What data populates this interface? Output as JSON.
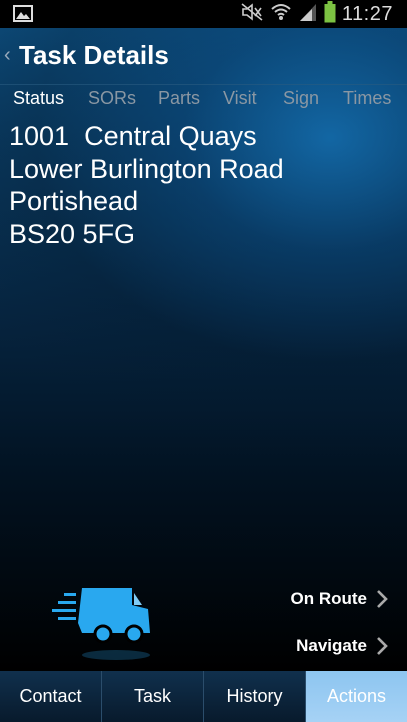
{
  "status_bar": {
    "time": "11:27",
    "icons": [
      "image-notification-icon",
      "mute-icon",
      "wifi-icon",
      "signal-icon",
      "battery-icon"
    ]
  },
  "header": {
    "title": "Task Details"
  },
  "tabs": [
    {
      "label": "Status",
      "active": true
    },
    {
      "label": "SORs",
      "active": false
    },
    {
      "label": "Parts",
      "active": false
    },
    {
      "label": "Visit",
      "active": false
    },
    {
      "label": "Sign",
      "active": false
    },
    {
      "label": "Times",
      "active": false
    }
  ],
  "address": {
    "line1": "1001  Central Quays",
    "line2": "Lower Burlington Road",
    "line3": "Portishead",
    "line4": "BS20 5FG"
  },
  "actions": {
    "on_route": "On Route",
    "navigate": "Navigate"
  },
  "bottom_tabs": [
    {
      "label": "Contact",
      "active": false
    },
    {
      "label": "Task",
      "active": false
    },
    {
      "label": "History",
      "active": false
    },
    {
      "label": "Actions",
      "active": true
    }
  ],
  "colors": {
    "accent": "#29a8ef",
    "active_tab_bg": "#9ccdf3"
  }
}
